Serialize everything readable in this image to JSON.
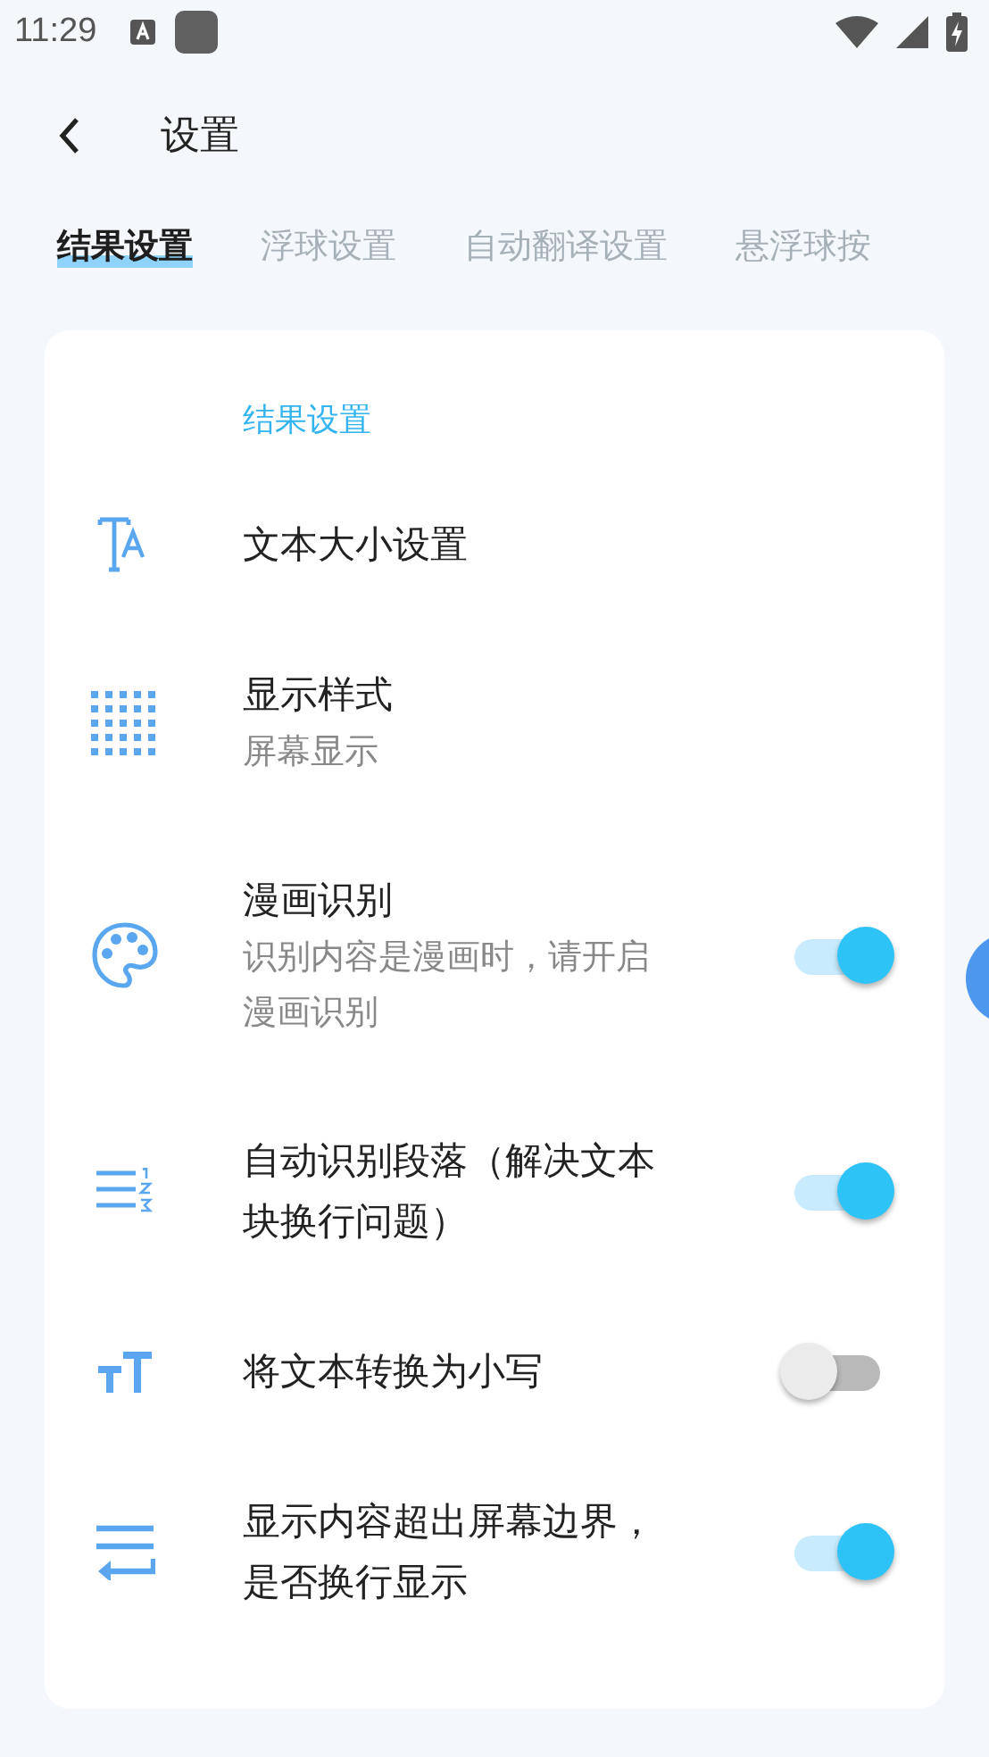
{
  "status_bar": {
    "time": "11:29"
  },
  "header": {
    "title": "设置"
  },
  "tabs": [
    {
      "label": "结果设置",
      "selected": true
    },
    {
      "label": "浮球设置",
      "selected": false
    },
    {
      "label": "自动翻译设置",
      "selected": false
    },
    {
      "label": "悬浮球按",
      "selected": false
    }
  ],
  "section": {
    "title": "结果设置"
  },
  "items": [
    {
      "title": "文本大小设置",
      "kind": "plain"
    },
    {
      "title": "显示样式",
      "subtitle": "屏幕显示",
      "kind": "plain"
    },
    {
      "title": "漫画识别",
      "subtitle": "识别内容是漫画时，请开启漫画识别",
      "kind": "toggle",
      "on": true
    },
    {
      "title": "自动识别段落（解决文本块换行问题）",
      "kind": "toggle",
      "on": true
    },
    {
      "title": "将文本转换为小写",
      "kind": "toggle",
      "on": false
    },
    {
      "title": "显示内容超出屏幕边界，是否换行显示",
      "kind": "toggle",
      "on": true
    }
  ]
}
